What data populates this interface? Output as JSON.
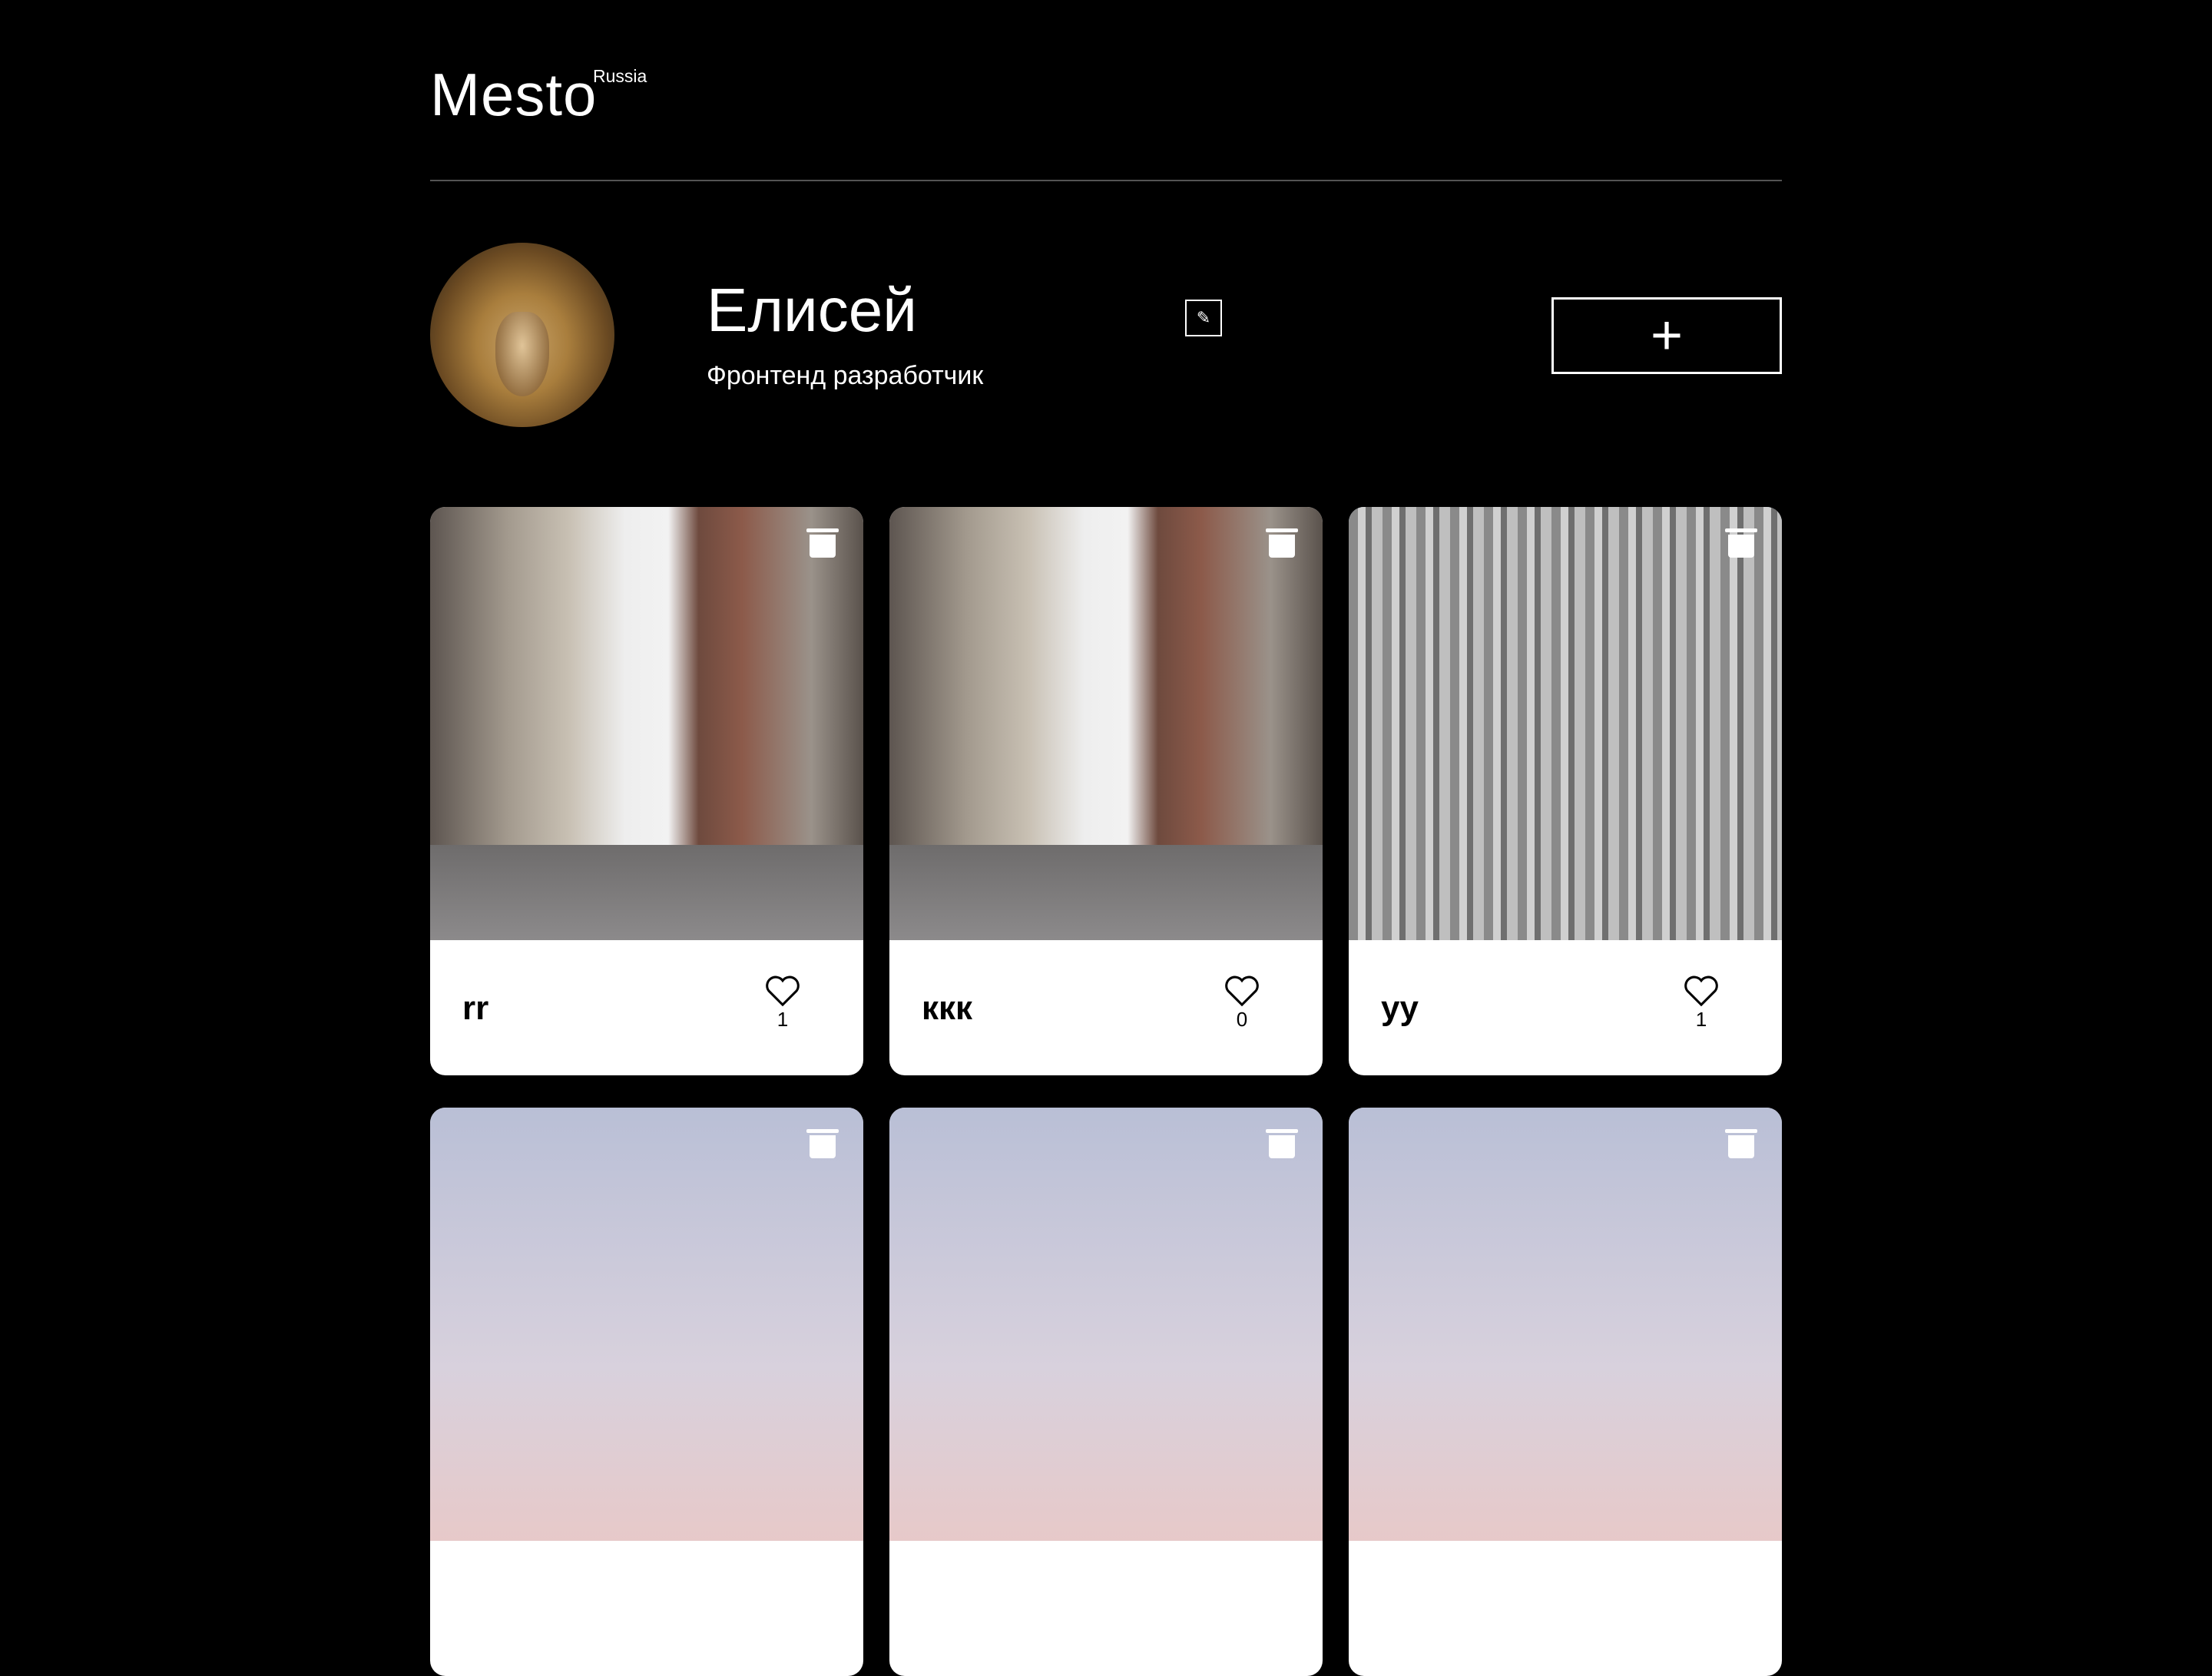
{
  "header": {
    "logo": "Mesto",
    "logo_sub": "Russia"
  },
  "profile": {
    "name": "Елисей",
    "about": "Фронтенд разработчик",
    "add_label": "+"
  },
  "cards": [
    {
      "title": "rr",
      "likes": "1",
      "image": "street"
    },
    {
      "title": "ккк",
      "likes": "0",
      "image": "street"
    },
    {
      "title": "уу",
      "likes": "1",
      "image": "city"
    },
    {
      "image": "sky"
    },
    {
      "image": "sky"
    },
    {
      "image": "sky"
    }
  ]
}
